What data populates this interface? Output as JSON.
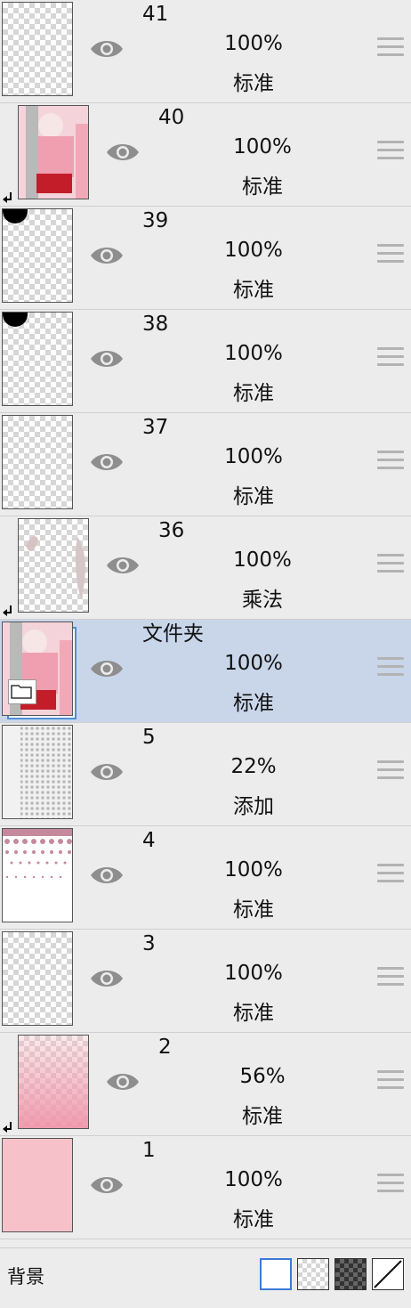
{
  "layers": [
    {
      "name": "41",
      "opacity": "100%",
      "blend": "标准",
      "clipped": false,
      "thumb": "empty"
    },
    {
      "name": "40",
      "opacity": "100%",
      "blend": "标准",
      "clipped": true,
      "thumb": "character"
    },
    {
      "name": "39",
      "opacity": "100%",
      "blend": "标准",
      "clipped": false,
      "thumb": "shape"
    },
    {
      "name": "38",
      "opacity": "100%",
      "blend": "标准",
      "clipped": false,
      "thumb": "shape"
    },
    {
      "name": "37",
      "opacity": "100%",
      "blend": "标准",
      "clipped": false,
      "thumb": "empty"
    },
    {
      "name": "36",
      "opacity": "100%",
      "blend": "乘法",
      "clipped": true,
      "thumb": "shadow"
    },
    {
      "name": "文件夹",
      "opacity": "100%",
      "blend": "标准",
      "clipped": false,
      "thumb": "folder",
      "selected": true
    },
    {
      "name": "5",
      "opacity": "22%",
      "blend": "添加",
      "clipped": false,
      "thumb": "halftone"
    },
    {
      "name": "4",
      "opacity": "100%",
      "blend": "标准",
      "clipped": false,
      "thumb": "hearts"
    },
    {
      "name": "3",
      "opacity": "100%",
      "blend": "标准",
      "clipped": false,
      "thumb": "empty"
    },
    {
      "name": "2",
      "opacity": "56%",
      "blend": "标准",
      "clipped": true,
      "thumb": "pink-gradient"
    },
    {
      "name": "1",
      "opacity": "100%",
      "blend": "标准",
      "clipped": false,
      "thumb": "pink-fill"
    }
  ],
  "background": {
    "label": "背景",
    "options": [
      "white",
      "transparent-light",
      "transparent-dark",
      "none"
    ],
    "selected": "white"
  },
  "colors": {
    "selected_row": "#c9d6ea",
    "selected_border": "#3d7bd6",
    "pink_fill": "#f6c1c9"
  },
  "icons": {
    "visibility": "eye-icon",
    "drag": "drag-handle-icon",
    "clip": "clip-arrow-icon",
    "folder": "folder-icon"
  }
}
